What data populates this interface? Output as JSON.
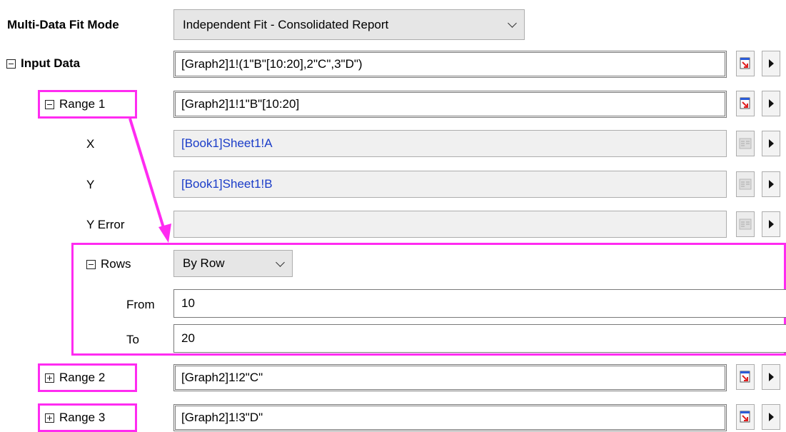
{
  "colors": {
    "highlight": "#ff2bf1",
    "link_text": "#1a3cc8"
  },
  "fit_mode": {
    "label": "Multi-Data Fit Mode",
    "value": "Independent Fit - Consolidated Report"
  },
  "input_data": {
    "label": "Input Data",
    "value": "[Graph2]1!(1\"B\"[10:20],2\"C\",3\"D\")"
  },
  "range1": {
    "label": "Range 1",
    "value": "[Graph2]1!1\"B\"[10:20]",
    "x": {
      "label": "X",
      "value": "[Book1]Sheet1!A"
    },
    "y": {
      "label": "Y",
      "value": "[Book1]Sheet1!B"
    },
    "yerr": {
      "label": "Y Error",
      "value": ""
    },
    "rows": {
      "label": "Rows",
      "mode": "By Row",
      "from": {
        "label": "From",
        "value": "10"
      },
      "to": {
        "label": "To",
        "value": "20"
      }
    }
  },
  "range2": {
    "label": "Range 2",
    "value": "[Graph2]1!2\"C\""
  },
  "range3": {
    "label": "Range 3",
    "value": "[Graph2]1!3\"D\""
  },
  "icons": {
    "select_range": "select-range-icon",
    "menu_arrow": "menu-arrow-icon",
    "collapse": "collapse-box-icon",
    "expand": "expand-box-icon"
  }
}
